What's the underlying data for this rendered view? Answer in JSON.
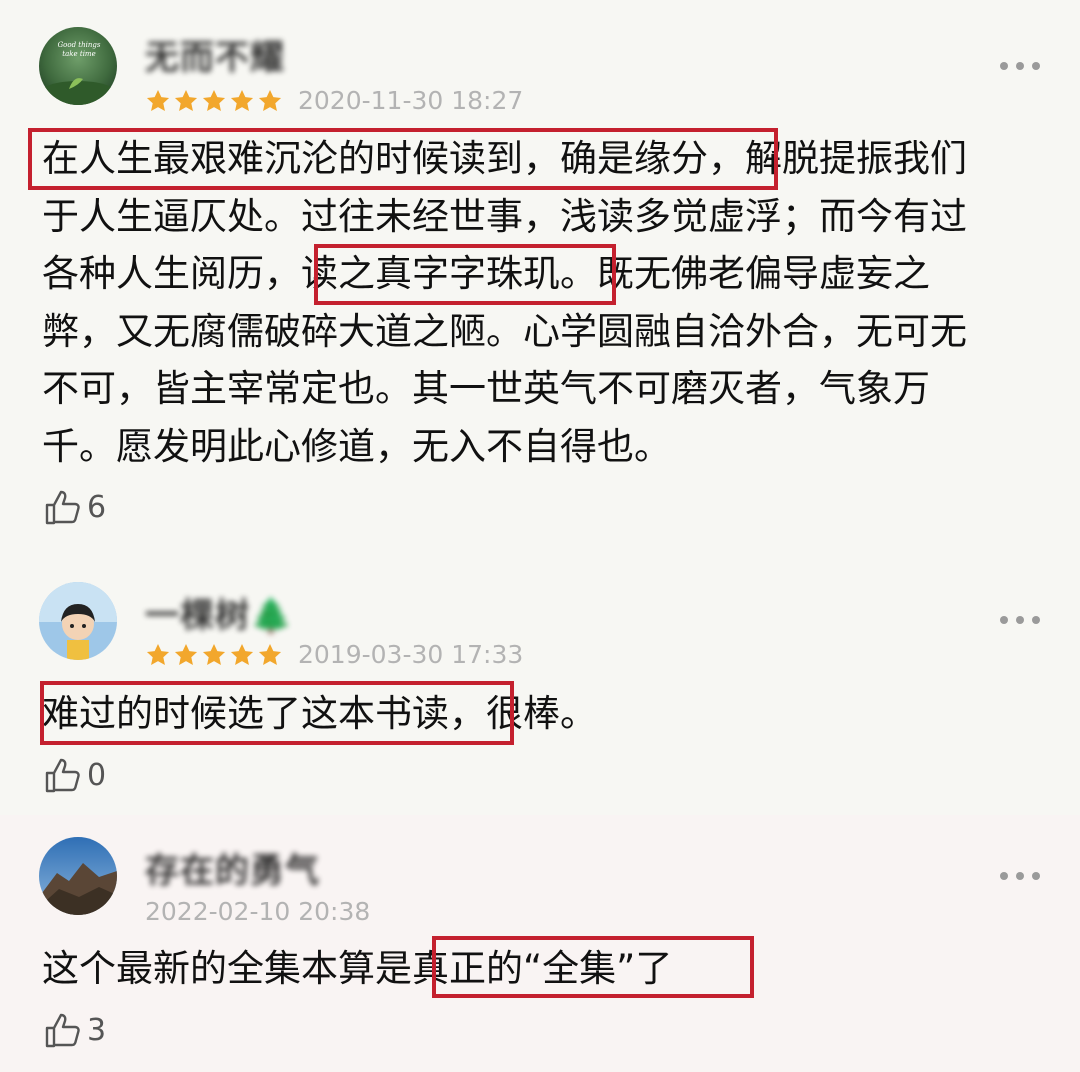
{
  "comments": [
    {
      "username": "无而不耀",
      "rating": 5,
      "date": "2020-11-30 18:27",
      "lines": [
        "在人生最艰难沉沦的时候读到，确是缘分，解脱提振我们",
        "于人生逼仄处。过往未经世事，浅读多觉虚浮；而今有过",
        "各种人生阅历，读之真字字珠玑。既无佛老偏导虚妄之",
        "弊，又无腐儒破碎大道之陋。心学圆融自洽外合，无可无",
        "不可，皆主宰常定也。其一世英气不可磨灭者，气象万",
        "千。愿发明此心修道，无入不自得也。"
      ],
      "likes": "6",
      "avatar_text": "Good things take time"
    },
    {
      "username": "一棵树🌲",
      "rating": 5,
      "date": "2019-03-30 17:33",
      "lines": [
        "难过的时候选了这本书读，很棒。"
      ],
      "likes": "0"
    },
    {
      "username": "存在的勇气",
      "date": "2022-02-10 20:38",
      "lines": [
        "这个最新的全集本算是真正的“全集”了"
      ],
      "likes": "3"
    }
  ],
  "icons": {
    "star": "star-icon",
    "like": "thumbs-up-icon",
    "more": "more-dots-icon"
  },
  "colors": {
    "star": "#f2a72c",
    "highlight_box": "#c4202e",
    "date": "#b3b3b3"
  }
}
